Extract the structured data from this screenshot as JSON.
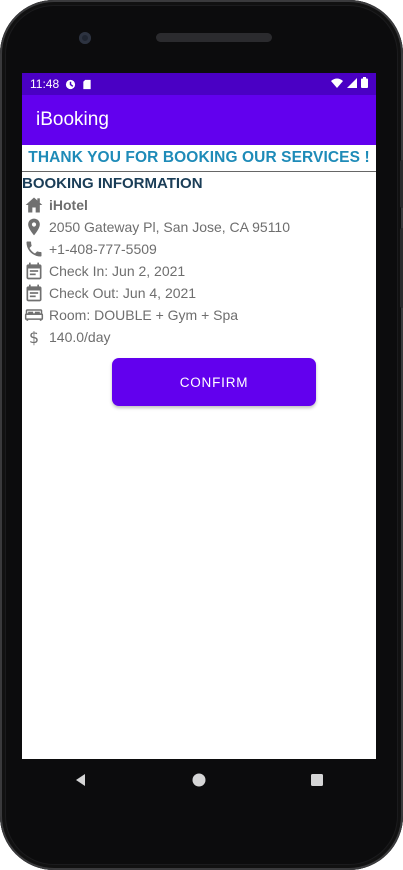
{
  "status_bar": {
    "time": "11:48",
    "icons": [
      "data-saver-icon",
      "sd-card-icon",
      "wifi-icon",
      "signal-icon",
      "battery-icon"
    ]
  },
  "app_bar": {
    "title": "iBooking"
  },
  "banner": {
    "text": "THANK YOU FOR BOOKING OUR SERVICES !"
  },
  "booking": {
    "section_title": "BOOKING INFORMATION",
    "hotel": "iHotel",
    "address": "2050 Gateway Pl, San Jose, CA 95110",
    "phone": "+1-408-777-5509",
    "check_in": "Check In: Jun 2, 2021",
    "check_out": "Check Out: Jun 4, 2021",
    "room": "Room: DOUBLE + Gym + Spa",
    "price": "140.0/day"
  },
  "actions": {
    "confirm_label": "CONFIRM"
  },
  "nav": {
    "items": [
      "back-icon",
      "home-icon",
      "recents-icon"
    ]
  },
  "colors": {
    "status_bar": "#4a00c4",
    "app_bar": "#6200ee",
    "banner_text": "#1e8bb8",
    "section_title": "#1a3d57",
    "info_text": "#6e6e6e",
    "button": "#6200ee"
  }
}
